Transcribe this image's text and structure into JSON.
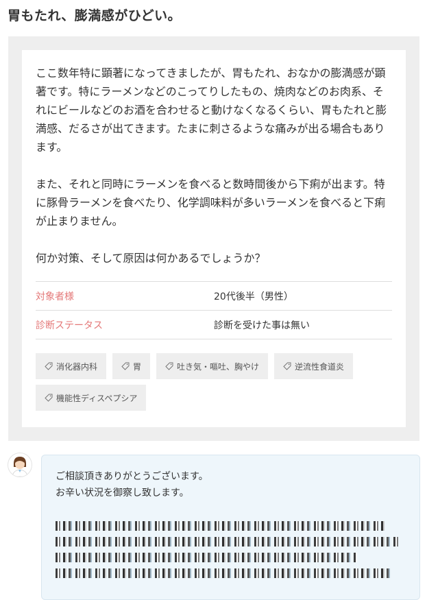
{
  "question": {
    "title": "胃もたれ、膨満感がひどい。",
    "paragraphs": [
      "ここ数年特に顕著になってきましたが、胃もたれ、おなかの膨満感が顕著です。特にラーメンなどのこってりしたもの、焼肉などのお肉系、それにビールなどのお酒を合わせると動けなくなるくらい、胃もたれと膨満感、だるさが出てきます。たまに刺さるような痛みが出る場合もあります。",
      "また、それと同時にラーメンを食べると数時間後から下痢が出ます。特に豚骨ラーメンを食べたり、化学調味料が多いラーメンを食べると下痢が止まりません。",
      "何か対策、そして原因は何かあるでしょうか？"
    ],
    "meta": [
      {
        "label": "対象者様",
        "value": "20代後半（男性）"
      },
      {
        "label": "診断ステータス",
        "value": "診断を受けた事は無い"
      }
    ],
    "tags": [
      "消化器内科",
      "胃",
      "吐き気・嘔吐、胸やけ",
      "逆流性食道炎",
      "機能性ディスペプシア"
    ]
  },
  "answer": {
    "lines": [
      "ご相談頂きありがとうございます。",
      "お辛い状況を御察し致します。"
    ]
  },
  "colors": {
    "frame_bg": "#eeeeee",
    "meta_label": "#e47878",
    "answer_bg": "#eef6fb"
  },
  "icons": {
    "tag": "tag-icon",
    "avatar": "doctor-avatar-icon"
  }
}
